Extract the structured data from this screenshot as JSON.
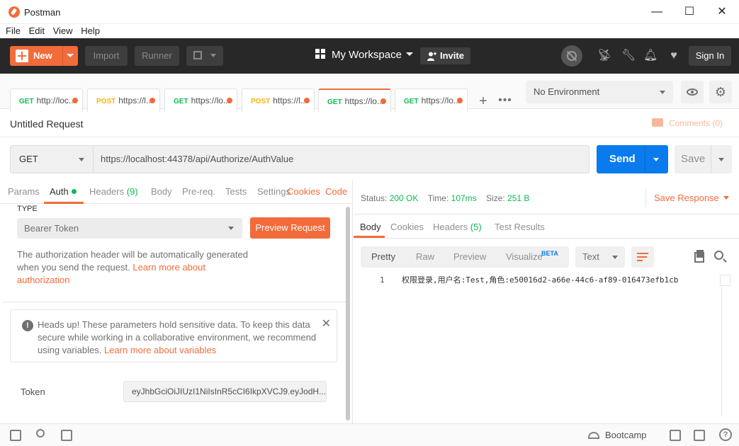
{
  "window": {
    "title": "Postman",
    "minimize": "—",
    "maximize": "☐",
    "close": "✕"
  },
  "menu": [
    "File",
    "Edit",
    "View",
    "Help"
  ],
  "header": {
    "new_label": "New",
    "import_label": "Import",
    "runner_label": "Runner",
    "workspace_label": "My Workspace",
    "invite_label": "Invite",
    "signin_label": "Sign In"
  },
  "tabs": [
    {
      "method": "GET",
      "url": "http://loc...",
      "color": "#0cbb52"
    },
    {
      "method": "POST",
      "url": "https://l...",
      "color": "#ffb400"
    },
    {
      "method": "GET",
      "url": "https://lo...",
      "color": "#0cbb52"
    },
    {
      "method": "POST",
      "url": "https://l...",
      "color": "#ffb400"
    },
    {
      "method": "GET",
      "url": "https://lo...",
      "color": "#0cbb52",
      "active": true
    },
    {
      "method": "GET",
      "url": "https://lo...",
      "color": "#0cbb52"
    }
  ],
  "environment": {
    "selected": "No Environment"
  },
  "request": {
    "title": "Untitled Request",
    "comments": "Comments (0)",
    "method": "GET",
    "url": "https://localhost:44378/api/Authorize/AuthValue",
    "send_label": "Send",
    "save_label": "Save"
  },
  "request_tabs": {
    "params": "Params",
    "auth": "Auth",
    "headers": "Headers",
    "headers_count": "(9)",
    "body": "Body",
    "prereq": "Pre-req.",
    "tests": "Tests",
    "settings": "Settings",
    "cookies": "Cookies",
    "code": "Code"
  },
  "auth": {
    "type_label": "TYPE",
    "type_value": "Bearer Token",
    "preview_label": "Preview Request",
    "desc_1": "The authorization header will be automatically generated",
    "desc_2": "when you send the request. ",
    "desc_link_1": "Learn more about",
    "desc_link_2": "authorization",
    "alert_1": "Heads up! These parameters hold sensitive data. To keep this data",
    "alert_2": "secure while working in a collaborative environment, we recommend",
    "alert_3": "using variables. ",
    "alert_link": "Learn more about variables",
    "token_label": "Token",
    "token_value": "eyJhbGciOiJIUzI1NiIsInR5cCI6IkpXVCJ9.eyJodH..."
  },
  "response": {
    "status_label": "Status:",
    "status_value": "200 OK",
    "time_label": "Time:",
    "time_value": "107ms",
    "size_label": "Size:",
    "size_value": "251 B",
    "save_response": "Save Response",
    "tabs": {
      "body": "Body",
      "cookies": "Cookies",
      "headers": "Headers",
      "headers_count": "(5)",
      "test_results": "Test Results"
    },
    "views": {
      "pretty": "Pretty",
      "raw": "Raw",
      "preview": "Preview",
      "visualize": "Visualize",
      "beta": "BETA"
    },
    "format": "Text",
    "line_number": "1",
    "body_text": "权限登录,用户名:Test,角色:e50016d2-a66e-44c6-af89-016473efb1cb"
  },
  "footer": {
    "bootcamp": "Bootcamp",
    "help": "?"
  },
  "colors": {
    "accent": "#f26b3a",
    "send": "#097bed",
    "ok": "#0cbb52",
    "dark_header": "#282828"
  }
}
